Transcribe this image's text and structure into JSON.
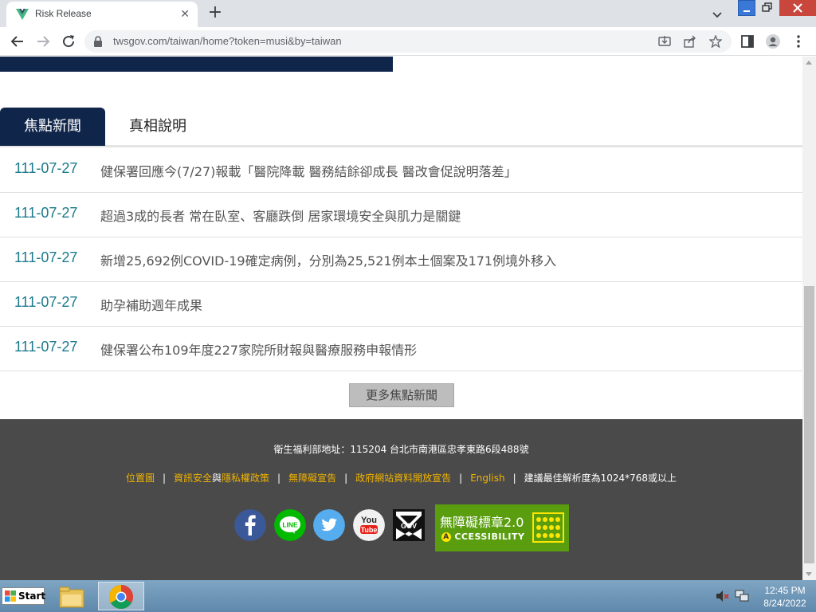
{
  "browser": {
    "tab_title": "Risk Release",
    "new_tab": "+",
    "url": "twsgov.com/taiwan/home?token=musi&by=taiwan"
  },
  "page": {
    "tabs": [
      {
        "label": "焦點新聞",
        "active": true
      },
      {
        "label": "真相說明",
        "active": false
      }
    ],
    "news": [
      {
        "date": "111-07-27",
        "title": "健保署回應今(7/27)報載「醫院降載 醫務結餘卻成長 醫改會促說明落差」"
      },
      {
        "date": "111-07-27",
        "title": "超過3成的長者 常在臥室、客廳跌倒 居家環境安全與肌力是關鍵"
      },
      {
        "date": "111-07-27",
        "title": "新增25,692例COVID-19確定病例，分別為25,521例本土個案及171例境外移入"
      },
      {
        "date": "111-07-27",
        "title": "助孕補助週年成果"
      },
      {
        "date": "111-07-27",
        "title": "健保署公布109年度227家院所財報與醫療服務申報情形"
      }
    ],
    "more_button": "更多焦點新聞"
  },
  "footer": {
    "address": "衛生福利部地址：115204 台北市南港區忠孝東路6段488號",
    "links": {
      "map": "位置圖",
      "security": "資訊安全",
      "and": "與",
      "privacy": "隱私權政策",
      "accessibility": "無障礙宣告",
      "open_data": "政府網站資料開放宣告",
      "english": "English",
      "resolution": "建議最佳解析度為1024*768或以上"
    },
    "social": [
      "facebook-icon",
      "line-icon",
      "twitter-icon",
      "youtube-icon",
      "gov-icon"
    ],
    "social_text": {
      "line": "LINE",
      "youtube_top": "You",
      "youtube_bottom": "Tube",
      "gov": "GOV"
    },
    "badge": {
      "title": "無障礙標章2.0",
      "subtitle": "CCESSIBILITY",
      "letter": "A"
    }
  },
  "taskbar": {
    "start_label": "Start",
    "time": "12:45 PM",
    "date": "8/24/2022"
  },
  "colors": {
    "navy": "#10254a",
    "date_teal": "#1b7a8c",
    "footer_bg": "#4a4a4a",
    "footer_link": "#f2b400",
    "badge_green": "#5a9e10"
  }
}
